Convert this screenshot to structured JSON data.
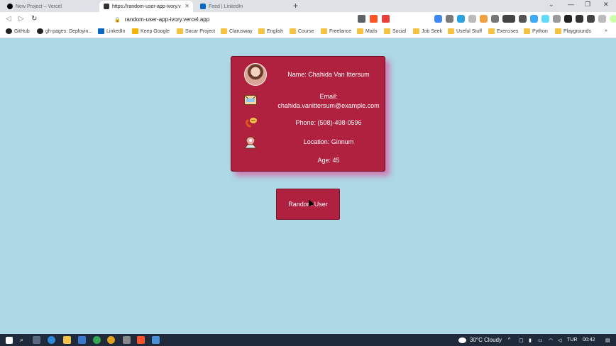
{
  "tabs": [
    {
      "label": "New Project – Vercel",
      "active": false
    },
    {
      "label": "https://random-user-app-ivory.v",
      "active": true
    },
    {
      "label": "Feed | LinkedIn",
      "active": false
    }
  ],
  "toolbar": {
    "url": "random-user-app-ivory.vercel.app"
  },
  "bookmarks": [
    {
      "label": "GitHub",
      "type": "github"
    },
    {
      "label": "gh-pages: Deployin...",
      "type": "github"
    },
    {
      "label": "LinkedIn",
      "type": "linkedin"
    },
    {
      "label": "Keep Google",
      "type": "keep"
    },
    {
      "label": "Socar Project",
      "type": "folder"
    },
    {
      "label": "Clarusway",
      "type": "folder"
    },
    {
      "label": "English",
      "type": "folder"
    },
    {
      "label": "Course",
      "type": "folder"
    },
    {
      "label": "Freelance",
      "type": "folder"
    },
    {
      "label": "Mails",
      "type": "folder"
    },
    {
      "label": "Social",
      "type": "folder"
    },
    {
      "label": "Job Seek",
      "type": "folder"
    },
    {
      "label": "Useful Stuff",
      "type": "folder"
    },
    {
      "label": "Exercises",
      "type": "folder"
    },
    {
      "label": "Python",
      "type": "folder"
    },
    {
      "label": "Playgrounds",
      "type": "folder"
    }
  ],
  "card": {
    "name": "Name: Chahida Van Ittersum",
    "email_label": "Email:",
    "email_value": "chahida.vanittersum@example.com",
    "phone": "Phone: (508)-498-0596",
    "location": "Location: Ginnum",
    "age": "Age: 45"
  },
  "button": {
    "label": "Random User"
  },
  "taskbar": {
    "weather": "30°C  Cloudy",
    "lang": "TUR",
    "time": "00:42"
  },
  "colors": {
    "page_bg": "#add8e6",
    "card_bg": "#b0203f",
    "card_shadow": "#e83c8c"
  }
}
